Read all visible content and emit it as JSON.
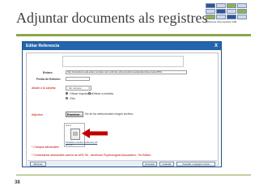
{
  "slide": {
    "title": "Adjuntar documents als registres",
    "page_number": "38"
  },
  "logo": {
    "text": "Biblioteca d'Humanitats UAB"
  },
  "dialog": {
    "title": "Editar Referencia",
    "close": "X",
    "url_label": "Enlace:",
    "url_value": "http://estudiosmedievales.revistas.csic.es/index.php/estudiosmedievales/issue/view/35/s",
    "date_label": "Fecha de Edición:",
    "date_value": "",
    "add_folder_label": "Añadir a la carpeta:",
    "folder_select": "- Sin carpeta -",
    "radio_options": [
      "Ofrece Impreso/ex",
      "Ofrece a medida",
      "Otro"
    ],
    "attachment_label": "Adjuntos:",
    "browse_button": "Examinar...",
    "browse_note": "No se ha seleccionado ningún archivo.",
    "preview_title": "Anexo",
    "preview_name": "Pantallazo estudios medievales.pdf",
    "preview_sub": "Eliminar",
    "additional_fields": "* Campos adicionales",
    "comments_note": "* Comentarios adicionales acerca de APA 7th - American Psychological Association, 7th Edition",
    "buttons": {
      "delete": "Eliminar",
      "cancel": "Cancelar",
      "save": "Guardar",
      "save_add": "Guardar y agregar nueva"
    }
  },
  "colors": {
    "accent": "#8aa64a",
    "header": "#2366ad",
    "arrow": "#c00000"
  }
}
